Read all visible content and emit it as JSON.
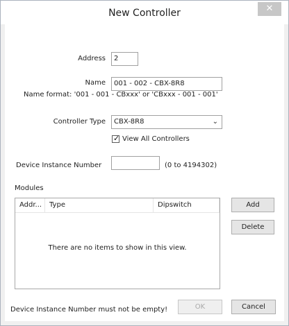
{
  "window": {
    "title": "New Controller",
    "close_glyph": "✕"
  },
  "form": {
    "address_label": "Address",
    "address_value": "2",
    "name_label": "Name",
    "name_value": "001 - 002 - CBX-8R8",
    "name_format_hint": "Name format: '001 - 001 - CBxxx' or 'CBxxx - 001 - 001'",
    "controller_type_label": "Controller Type",
    "controller_type_value": "CBX-8R8",
    "view_all_label": "View All Controllers",
    "view_all_checked": true,
    "device_instance_label": "Device Instance Number",
    "device_instance_value": "",
    "device_instance_range": "(0 to 4194302)"
  },
  "modules": {
    "label": "Modules",
    "columns": [
      "Addr...",
      "Type",
      "Dipswitch"
    ],
    "empty_text": "There are no items to show in this view.",
    "add_label": "Add",
    "delete_label": "Delete"
  },
  "footer": {
    "error_message": "Device Instance Number must not be empty!",
    "ok_label": "OK",
    "cancel_label": "Cancel"
  },
  "icons": {
    "close": "close-icon",
    "dropdown": "chevron-down-icon",
    "check": "checkmark-icon"
  }
}
